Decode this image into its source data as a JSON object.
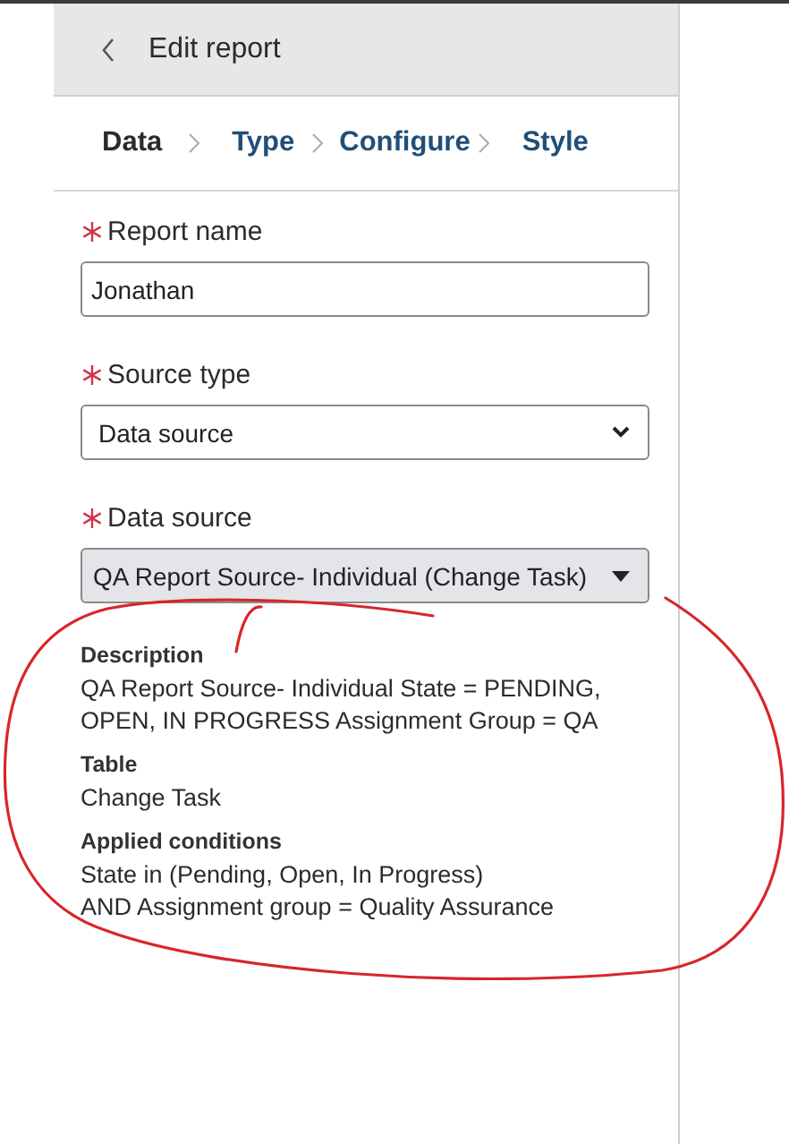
{
  "header": {
    "title": "Edit report"
  },
  "steps": [
    {
      "label": "Data",
      "selected": true
    },
    {
      "label": "Type",
      "selected": false
    },
    {
      "label": "Configure",
      "selected": false
    },
    {
      "label": "Style",
      "selected": false
    }
  ],
  "fields": [
    {
      "kind": "text",
      "label": "Report name",
      "required": true,
      "value": "Jonathan"
    },
    {
      "kind": "select",
      "label": "Source type",
      "required": true,
      "value": "Data source"
    },
    {
      "kind": "picker",
      "label": "Data source",
      "required": true,
      "value": "QA Report Source- Individual (Change Task)"
    }
  ],
  "details": [
    {
      "heading": "Description",
      "lines": [
        "QA Report Source- Individual State = PENDING, OPEN, IN PROGRESS Assignment Group = QA"
      ]
    },
    {
      "heading": "Table",
      "lines": [
        "Change Task"
      ]
    },
    {
      "heading": "Applied conditions",
      "lines": [
        "State in (Pending, Open, In Progress)",
        "AND Assignment group = Quality Assurance"
      ]
    }
  ]
}
